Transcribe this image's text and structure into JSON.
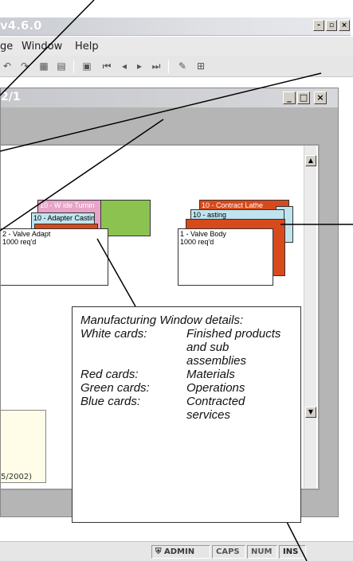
{
  "app": {
    "title": "v4.6.0",
    "buttons": {
      "minimize": "-",
      "restore": "▫",
      "close": "×"
    }
  },
  "menu": {
    "items": [
      "ge",
      "Window",
      "Help"
    ]
  },
  "toolbar": {
    "glyphs": [
      "↶",
      "↷",
      "▦",
      "▤",
      "▣",
      "⏮",
      "◂",
      "▸",
      "⏭",
      "✎",
      "⊞"
    ]
  },
  "child_window": {
    "title": "2/1",
    "buttons": {
      "minimize": "_",
      "maximize": "□",
      "close": "×"
    }
  },
  "cards": {
    "left_group": {
      "pink": "10 - W    ide Turnin",
      "blue": "10 - Adapter Castin",
      "white_line1": "2 - Valve Adapt",
      "white_line2": "1000 req'd"
    },
    "right_group": {
      "red": "10 - Contract Lathe",
      "blue": "10 -           asting",
      "white_line1": "1 - Valve Body",
      "white_line2": "1000 req'd"
    }
  },
  "note": {
    "text": "5/2002)"
  },
  "status": {
    "user": "ADMIN",
    "caps": "CAPS",
    "num": "NUM",
    "ins": "INS"
  },
  "legend": {
    "heading": "Manufacturing Window details:",
    "rows": [
      {
        "key": "White cards:",
        "value": "Finished products and sub assemblies"
      },
      {
        "key": "Red cards:",
        "value": "Materials"
      },
      {
        "key": "Green cards:",
        "value": "Operations"
      },
      {
        "key": "Blue cards:",
        "value": "Contracted services"
      }
    ]
  }
}
